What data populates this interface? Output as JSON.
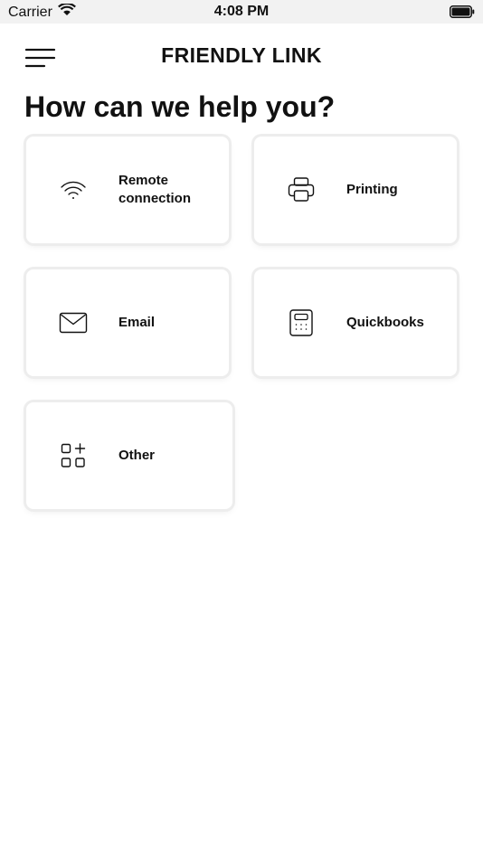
{
  "status_bar": {
    "carrier": "Carrier",
    "time": "4:08 PM"
  },
  "header": {
    "title": "FRIENDLY LINK",
    "menu_icon": "hamburger-menu-icon"
  },
  "page": {
    "heading": "How can we help you?"
  },
  "categories": [
    {
      "label": "Remote\nconnection",
      "icon": "wifi-icon"
    },
    {
      "label": "Printing",
      "icon": "printer-icon"
    },
    {
      "label": "Email",
      "icon": "envelope-icon"
    },
    {
      "label": "Quickbooks",
      "icon": "calculator-icon"
    },
    {
      "label": "Other",
      "icon": "apps-plus-icon"
    }
  ]
}
